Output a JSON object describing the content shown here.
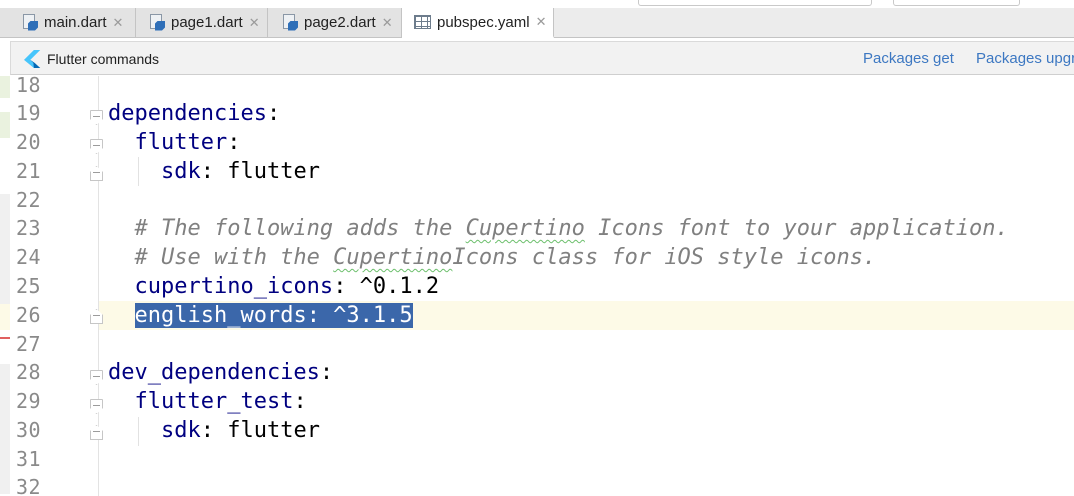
{
  "tabs": [
    {
      "label": "main.dart",
      "icon": "dart-file-icon",
      "active": false
    },
    {
      "label": "page1.dart",
      "icon": "dart-file-icon",
      "active": false
    },
    {
      "label": "page2.dart",
      "icon": "dart-file-icon",
      "active": false
    },
    {
      "label": "pubspec.yaml",
      "icon": "yaml-file-icon",
      "active": true
    }
  ],
  "close_glyph": "✕",
  "flutter_bar": {
    "title": "Flutter commands",
    "packages_get": "Packages get",
    "packages_upgrade": "Packages upgra"
  },
  "editor": {
    "current_line": 26,
    "selection": "english_words: ^3.1.5",
    "colors": {
      "key": "#000080",
      "comment": "#808080",
      "selection": "#3b67aa",
      "current_line": "#fdfae7"
    },
    "lines": [
      {
        "num": "18",
        "text": ""
      },
      {
        "num": "19",
        "text": "dependencies:"
      },
      {
        "num": "20",
        "text": "  flutter:"
      },
      {
        "num": "21",
        "text": "    sdk: flutter"
      },
      {
        "num": "22",
        "text": ""
      },
      {
        "num": "23",
        "text": "  # The following adds the Cupertino Icons font to your application."
      },
      {
        "num": "24",
        "text": "  # Use with the CupertinoIcons class for iOS style icons."
      },
      {
        "num": "25",
        "text": "  cupertino_icons: ^0.1.2"
      },
      {
        "num": "26",
        "text": "  english_words: ^3.1.5"
      },
      {
        "num": "27",
        "text": ""
      },
      {
        "num": "28",
        "text": "dev_dependencies:"
      },
      {
        "num": "29",
        "text": "  flutter_test:"
      },
      {
        "num": "30",
        "text": "    sdk: flutter"
      },
      {
        "num": "31",
        "text": ""
      },
      {
        "num": "32",
        "text": ""
      }
    ]
  }
}
